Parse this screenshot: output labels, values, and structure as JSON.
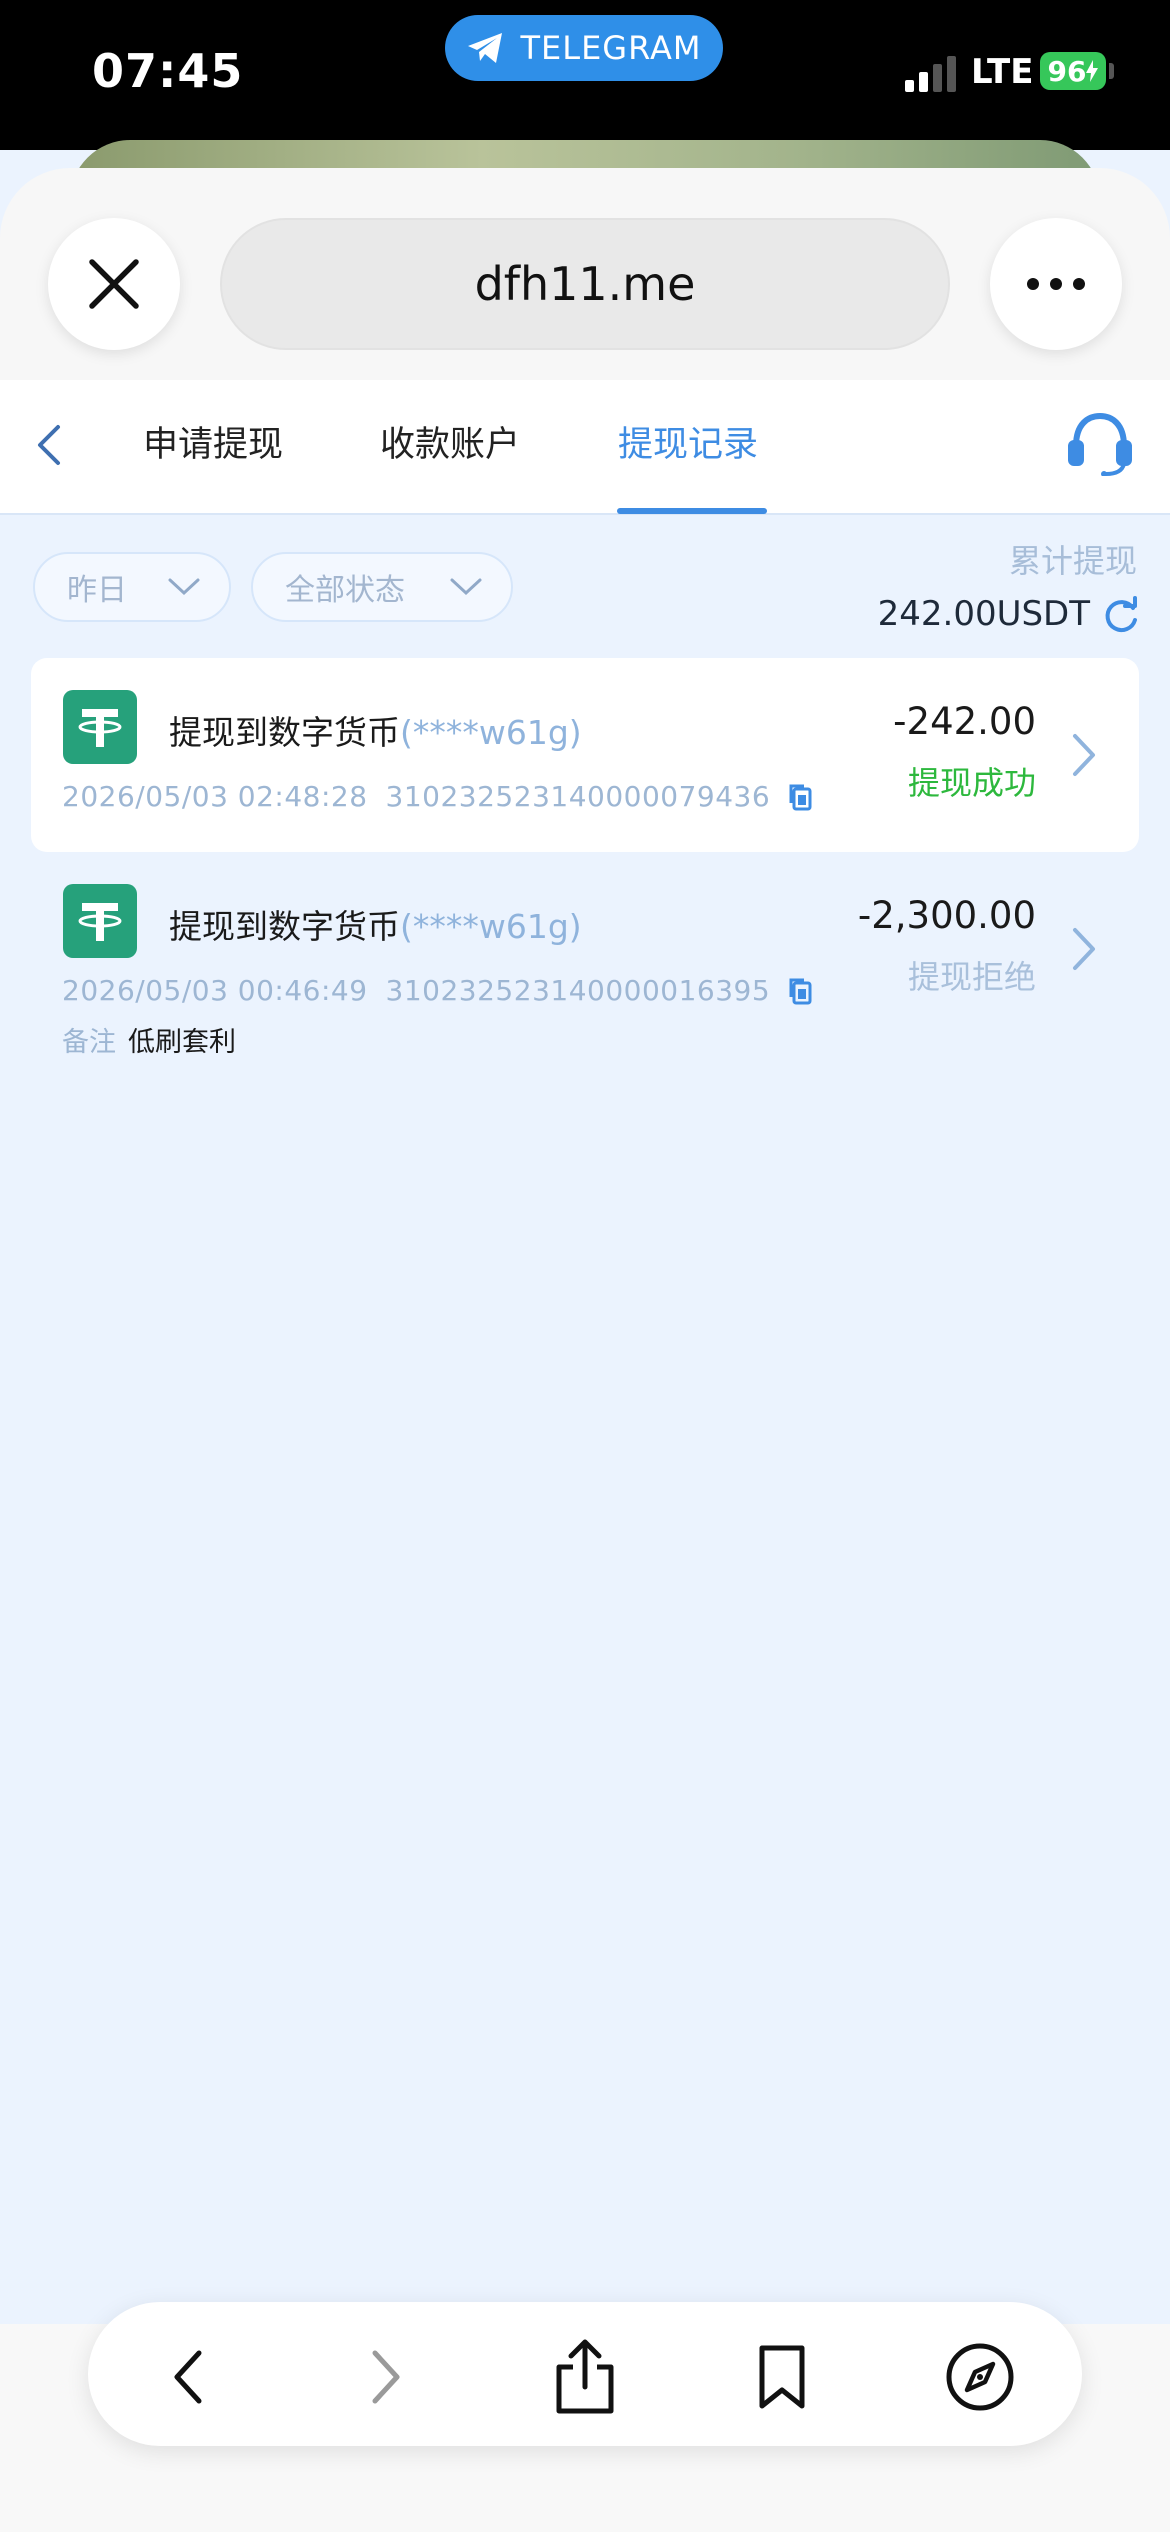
{
  "status_bar": {
    "time": "07:45",
    "telegram_label": "TELEGRAM",
    "network": "LTE",
    "battery": "96"
  },
  "browser": {
    "url": "dfh11.me"
  },
  "tabs": [
    {
      "label": "申请提现",
      "active": false
    },
    {
      "label": "收款账户",
      "active": false
    },
    {
      "label": "提现记录",
      "active": true
    }
  ],
  "filters": {
    "date": "昨日",
    "status": "全部状态"
  },
  "total": {
    "label": "累计提现",
    "amount": "242.00USDT"
  },
  "records": [
    {
      "title": "提现到数字货币",
      "masked_account": "(****w61g)",
      "datetime": "2026/05/03 02:48:28",
      "order_id": "310232523140000079436",
      "amount": "-242.00",
      "status": "提现成功",
      "status_color": "#2db83d"
    },
    {
      "title": "提现到数字货币",
      "masked_account": "(****w61g)",
      "datetime": "2026/05/03 00:46:49",
      "order_id": "310232523140000016395",
      "amount": "-2,300.00",
      "status": "提现拒绝",
      "status_color": "#a9c0db",
      "note_label": "备注",
      "note_text": "低刷套利"
    }
  ],
  "colors": {
    "accent": "#3e8ce3",
    "page_bg": "#ebf3fe",
    "tether_green": "#26a17b"
  },
  "icons": [
    "close-icon",
    "more-icon",
    "back-chevron-icon",
    "headset-icon",
    "chevron-down-icon",
    "refresh-icon",
    "tether-icon",
    "copy-icon",
    "chevron-right-icon",
    "share-icon",
    "bookmark-icon",
    "compass-icon",
    "telegram-icon"
  ]
}
